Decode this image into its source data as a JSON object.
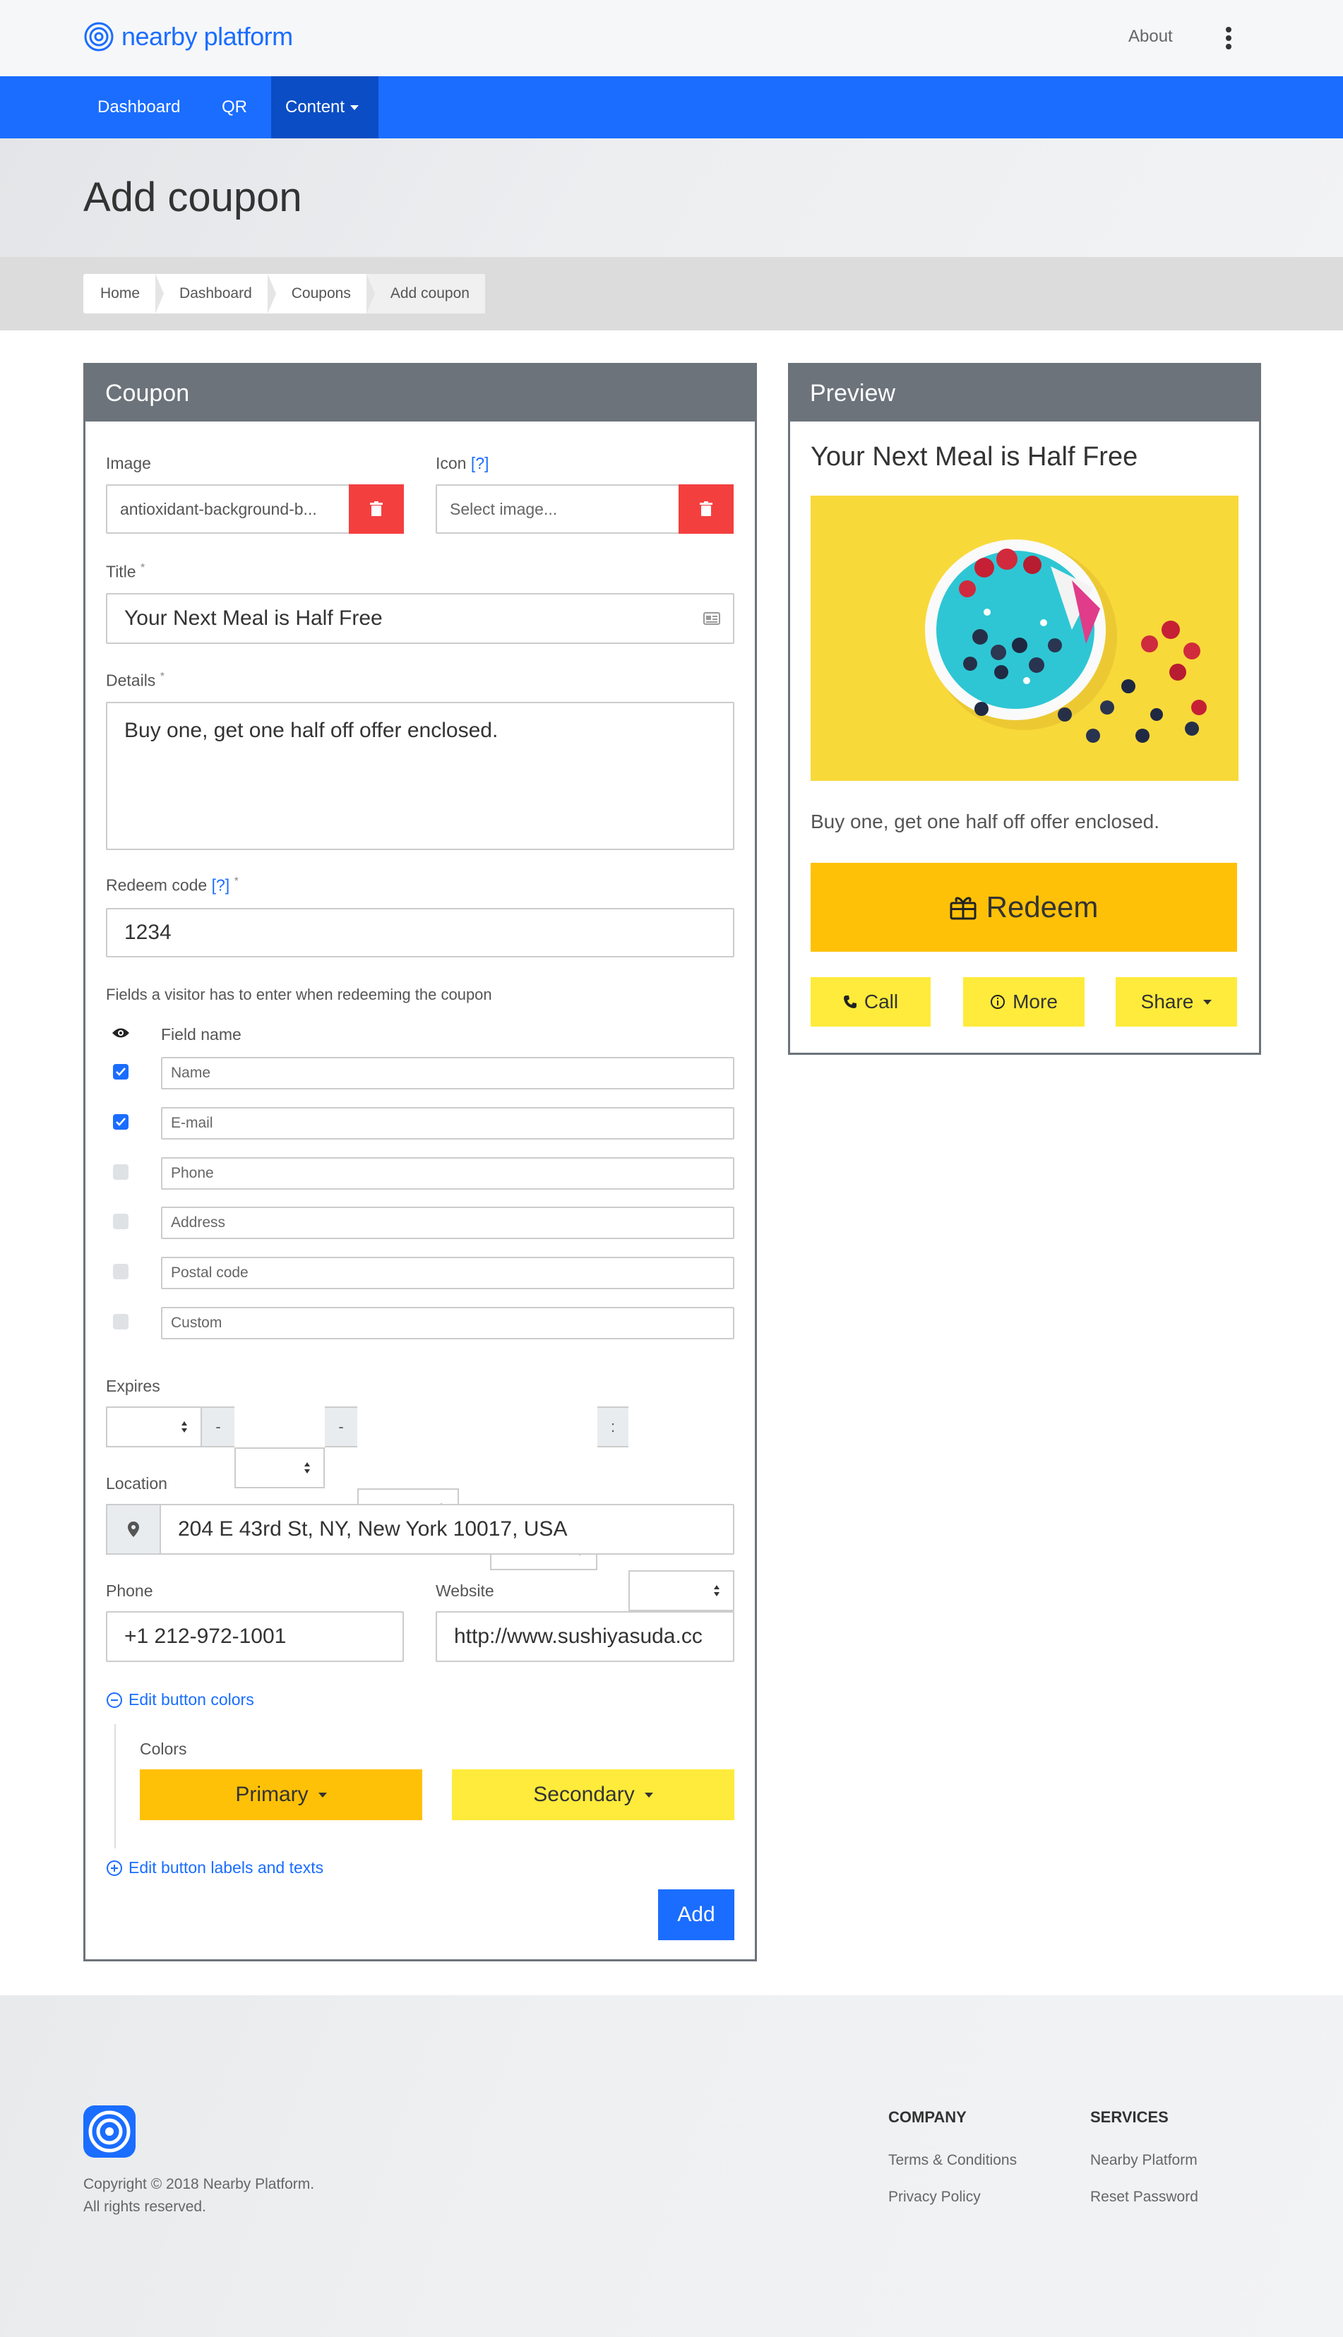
{
  "app": {
    "brand": "nearby platform",
    "brand_color": "#1a6dff",
    "about": "About"
  },
  "nav": {
    "items": [
      "Dashboard",
      "QR",
      "Content"
    ],
    "active": "Content"
  },
  "page": {
    "title": "Add coupon"
  },
  "breadcrumb": [
    "Home",
    "Dashboard",
    "Coupons",
    "Add coupon"
  ],
  "coupon": {
    "heading": "Coupon",
    "image_label": "Image",
    "image_value": "antioxidant-background-b...",
    "icon_label": "Icon",
    "help": "[?]",
    "icon_placeholder": "Select image...",
    "title_label": "Title",
    "required": "*",
    "title_value": "Your Next Meal is Half Free",
    "details_label": "Details",
    "details_value": "Buy one, get one half off offer enclosed.",
    "redeem_label": "Redeem code",
    "redeem_value": "1234",
    "fields_caption": "Fields a visitor has to enter when redeeming the coupon",
    "field_name_header": "Field name",
    "fields": [
      {
        "name": "Name",
        "checked": true
      },
      {
        "name": "E-mail",
        "checked": true
      },
      {
        "name": "Phone",
        "checked": false
      },
      {
        "name": "Address",
        "checked": false
      },
      {
        "name": "Postal code",
        "checked": false
      },
      {
        "name": "Custom",
        "checked": false
      }
    ],
    "expires_label": "Expires",
    "date_sep": "-",
    "time_sep": ":",
    "location_label": "Location",
    "location_value": "204 E 43rd St, NY, New York 10017, USA",
    "phone_label": "Phone",
    "phone_value": "+1 212-972-1001",
    "website_label": "Website",
    "website_value": "http://www.sushiyasuda.cc",
    "edit_colors": "Edit button colors",
    "colors_label": "Colors",
    "primary": "Primary",
    "secondary": "Secondary",
    "primary_color": "#ffc107",
    "secondary_color": "#ffeb3b",
    "edit_labels": "Edit button labels and texts",
    "add": "Add"
  },
  "preview": {
    "heading": "Preview",
    "title": "Your Next Meal is Half Free",
    "details": "Buy one, get one half off offer enclosed.",
    "redeem": "Redeem",
    "call": "Call",
    "more": "More",
    "share": "Share"
  },
  "footer": {
    "copyright_line1": "Copyright © 2018 Nearby Platform.",
    "copyright_line2": "All rights reserved.",
    "company_heading": "COMPANY",
    "company_links": [
      "Terms & Conditions",
      "Privacy Policy"
    ],
    "services_heading": "SERVICES",
    "services_links": [
      "Nearby Platform",
      "Reset Password"
    ]
  }
}
